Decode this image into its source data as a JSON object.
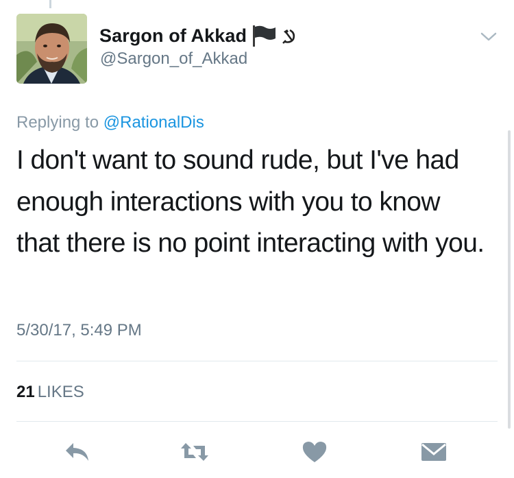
{
  "tweet": {
    "author": {
      "display_name": "Sargon of Akkad",
      "name_emojis": [
        "black-flag-icon",
        "hammer-sickle-icon"
      ],
      "handle": "@Sargon_of_Akkad",
      "avatar": "avatar-photo"
    },
    "replying_prefix": "Replying to",
    "replying_to": "@RationalDis",
    "text": "I don't want to sound rude, but I've had enough interactions with you to know that there is no point interacting with you.",
    "timestamp": "5/30/17, 5:49 PM",
    "likes_count": "21",
    "likes_label": "LIKES"
  },
  "actions": [
    {
      "name": "reply",
      "icon": "reply-icon"
    },
    {
      "name": "retweet",
      "icon": "retweet-icon"
    },
    {
      "name": "like",
      "icon": "heart-icon"
    },
    {
      "name": "direct-message",
      "icon": "envelope-icon"
    }
  ],
  "colors": {
    "text": "#14171a",
    "secondary": "#657786",
    "link": "#1b95e0",
    "icon": "#8899a6",
    "divider": "#e1e8ed"
  }
}
